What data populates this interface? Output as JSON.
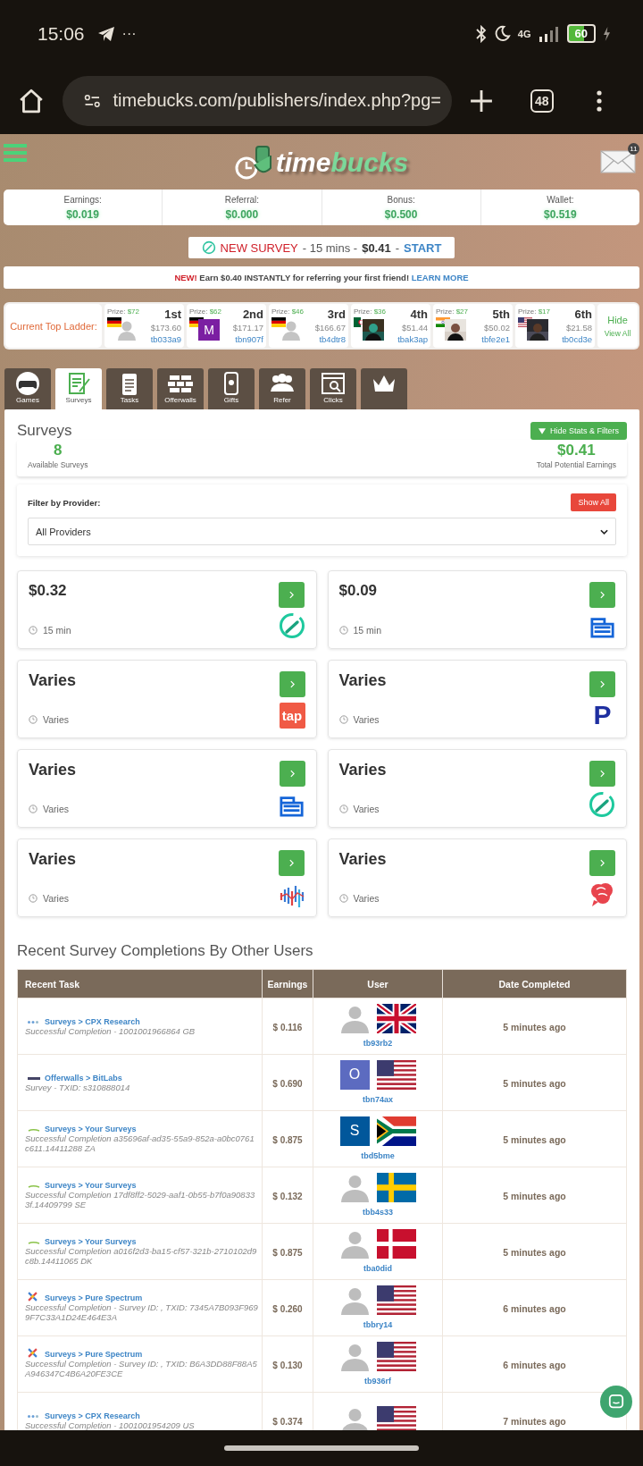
{
  "status_bar": {
    "time": "15:06",
    "more": "···",
    "network": "4G",
    "battery": "60"
  },
  "browser": {
    "url": "timebucks.com/publishers/index.php?pg=",
    "tab_count": "48"
  },
  "header": {
    "logo": {
      "prefix": "time",
      "suffix": "bucks"
    },
    "mail_badge": "11"
  },
  "balances": [
    {
      "label": "Earnings:",
      "value": "$0.019"
    },
    {
      "label": "Referral:",
      "value": "$0.000"
    },
    {
      "label": "Bonus:",
      "value": "$0.500"
    },
    {
      "label": "Wallet:",
      "value": "$0.519"
    }
  ],
  "new_survey": {
    "label": "NEW SURVEY",
    "duration": "- 15 mins -",
    "amount": "$0.41",
    "separator": "-",
    "action": "START"
  },
  "referral": {
    "badge": "NEW!",
    "text": "Earn $0.40 INSTANTLY for referring your first friend!",
    "link": "LEARN MORE"
  },
  "ladder": {
    "title": "Current Top Ladder:",
    "hide": "Hide",
    "view_all": "View All",
    "entries": [
      {
        "prize_label": "Prize:",
        "prize": "$72",
        "rank": "1st",
        "amount": "$173.60",
        "user": "tb033a9",
        "flag": {
          "kind": "de"
        },
        "avatar": {
          "kind": "silhouette"
        }
      },
      {
        "prize_label": "Prize:",
        "prize": "$62",
        "rank": "2nd",
        "amount": "$171.17",
        "user": "tbn907f",
        "flag": {
          "kind": "de"
        },
        "avatar": {
          "kind": "letter",
          "letter": "M",
          "color": "#7b1fa2"
        }
      },
      {
        "prize_label": "Prize:",
        "prize": "$46",
        "rank": "3rd",
        "amount": "$166.67",
        "user": "tb4dtr8",
        "flag": {
          "kind": "de"
        },
        "avatar": {
          "kind": "silhouette"
        }
      },
      {
        "prize_label": "Prize:",
        "prize": "$36",
        "rank": "4th",
        "amount": "$51.44",
        "user": "tbak3ap",
        "flag": {
          "kind": "dz"
        }
      },
      {
        "prize_label": "Prize:",
        "prize": "$27",
        "rank": "5th",
        "amount": "$50.02",
        "user": "tbfe2e1",
        "flag": {
          "kind": "in"
        }
      },
      {
        "prize_label": "Prize:",
        "prize": "$17",
        "rank": "6th",
        "amount": "$21.58",
        "user": "tb0cd3e",
        "flag": {
          "kind": "us"
        }
      }
    ]
  },
  "tabs": [
    {
      "label": "Games",
      "kind": "gamepad",
      "selected": false
    },
    {
      "label": "Surveys",
      "kind": "notepad",
      "selected": true
    },
    {
      "label": "Tasks",
      "kind": "clipboard",
      "selected": false
    },
    {
      "label": "Offerwalls",
      "kind": "bricks",
      "selected": false
    },
    {
      "label": "Gifts",
      "kind": "phone",
      "selected": false
    },
    {
      "label": "Refer",
      "kind": "people",
      "selected": false
    },
    {
      "label": "Clicks",
      "kind": "browser",
      "selected": false
    },
    {
      "kind": "crown",
      "selected": false
    }
  ],
  "surveys": {
    "title": "Surveys",
    "toggle": "Hide Stats & Filters",
    "count": "8",
    "count_label": "Available Surveys",
    "total": "$0.41",
    "total_label": "Total Potential Earnings",
    "filter_label": "Filter by Provider:",
    "show_all": "Show All",
    "provider": "All Providers",
    "cards": [
      {
        "amount": "$0.32",
        "time": "15 min",
        "kind": "check"
      },
      {
        "amount": "$0.09",
        "time": "15 min",
        "kind": "blocks"
      },
      {
        "amount": "Varies",
        "time": "Varies",
        "kind": "tap",
        "logo_text": "tap"
      },
      {
        "amount": "Varies",
        "time": "Varies",
        "kind": "letter",
        "logo_text": "P"
      },
      {
        "amount": "Varies",
        "time": "Varies",
        "kind": "blocks"
      },
      {
        "amount": "Varies",
        "time": "Varies",
        "kind": "check"
      },
      {
        "amount": "Varies",
        "time": "Varies",
        "kind": "bars"
      },
      {
        "amount": "Varies",
        "time": "Varies",
        "kind": "brain"
      }
    ]
  },
  "recent": {
    "title": "Recent Survey Completions By Other Users",
    "columns": [
      "Recent Task",
      "Earnings",
      "User",
      "Date Completed"
    ],
    "rows": [
      {
        "kind": "dots",
        "task": "Surveys > CPX Research",
        "detail": "Successful Completion - 1001001966864 GB",
        "earnings": "$ 0.116",
        "avatar": {
          "kind": "silhouette"
        },
        "flag": {
          "kind": "gb"
        },
        "user": "tb93rb2",
        "date": "5 minutes ago"
      },
      {
        "kind": "bar",
        "task": "Offerwalls > BitLabs",
        "detail": "Survey - TXID: s310888014",
        "earnings": "$ 0.690",
        "avatar": {
          "kind": "letter",
          "letter": "O",
          "color": "#5c6bc0"
        },
        "flag": {
          "kind": "us"
        },
        "user": "tbn74ax",
        "date": "5 minutes ago"
      },
      {
        "kind": "swoosh",
        "task": "Surveys > Your Surveys",
        "detail": "Successful Completion a35696af-ad35-55a9-852a-a0bc0761c611.14411288 ZA",
        "earnings": "$ 0.875",
        "avatar": {
          "kind": "letter",
          "letter": "S",
          "color": "#01579b"
        },
        "flag": {
          "kind": "za"
        },
        "user": "tbd5bme",
        "date": "5 minutes ago"
      },
      {
        "kind": "swoosh",
        "task": "Surveys > Your Surveys",
        "detail": "Successful Completion 17df8ff2-5029-aaf1-0b55-b7f0a908333f.14409799 SE",
        "earnings": "$ 0.132",
        "avatar": {
          "kind": "silhouette"
        },
        "flag": {
          "kind": "se"
        },
        "user": "tbb4s33",
        "date": "5 minutes ago"
      },
      {
        "kind": "swoosh",
        "task": "Surveys > Your Surveys",
        "detail": "Successful Completion a016f2d3-ba15-cf57-321b-2710102d9c8b.14411065 DK",
        "earnings": "$ 0.875",
        "avatar": {
          "kind": "silhouette"
        },
        "flag": {
          "kind": "dk"
        },
        "user": "tba0did",
        "date": "5 minutes ago"
      },
      {
        "kind": "cross",
        "task": "Surveys > Pure Spectrum",
        "detail": "Successful Completion - Survey ID: , TXID: 7345A7B093F9699F7C33A1D24E464E3A",
        "earnings": "$ 0.260",
        "avatar": {
          "kind": "silhouette"
        },
        "flag": {
          "kind": "us"
        },
        "user": "tbbry14",
        "date": "6 minutes ago"
      },
      {
        "kind": "cross",
        "task": "Surveys > Pure Spectrum",
        "detail": "Successful Completion - Survey ID: , TXID: B6A3DD88F88A5A946347C4B6A20FE3CE",
        "earnings": "$ 0.130",
        "avatar": {
          "kind": "silhouette"
        },
        "flag": {
          "kind": "us"
        },
        "user": "tb936rf",
        "date": "6 minutes ago"
      },
      {
        "kind": "dots",
        "task": "Surveys > CPX Research",
        "detail": "Successful Completion - 1001001954209 US",
        "earnings": "$ 0.374",
        "avatar": {
          "kind": "silhouette"
        },
        "flag": {
          "kind": "us"
        },
        "date": "7 minutes ago"
      }
    ]
  }
}
